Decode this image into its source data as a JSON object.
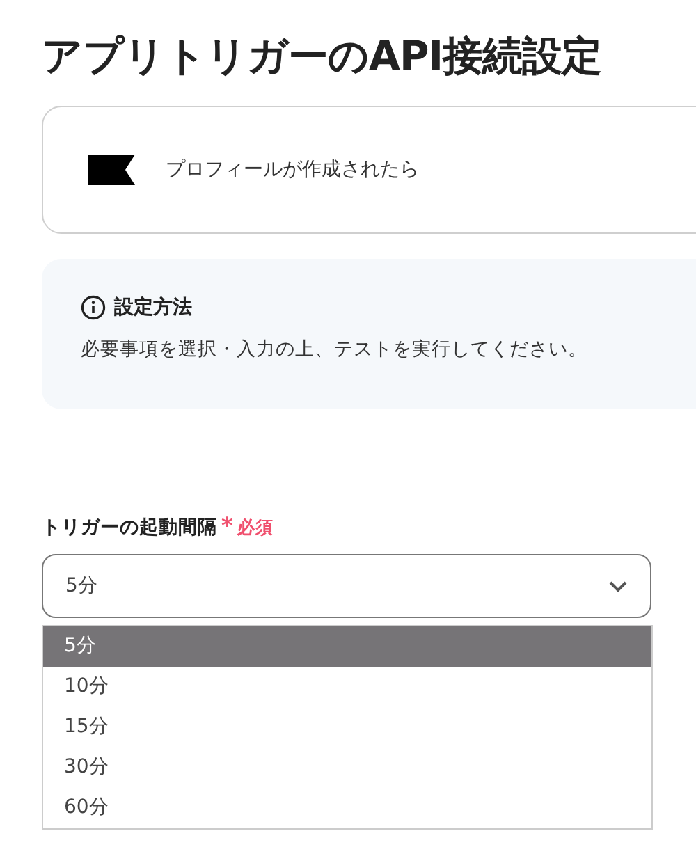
{
  "title": "アプリトリガーのAPI接続設定",
  "trigger_card": {
    "label": "プロフィールが作成されたら"
  },
  "info": {
    "heading": "設定方法",
    "text": "必要事項を選択・入力の上、テストを実行してください。"
  },
  "field": {
    "label": "トリガーの起動間隔",
    "required_mark": "*",
    "required_label": "必須",
    "value": "5分",
    "expanded": true,
    "options": [
      {
        "label": "5分",
        "selected": true
      },
      {
        "label": "10分",
        "selected": false
      },
      {
        "label": "15分",
        "selected": false
      },
      {
        "label": "30分",
        "selected": false
      },
      {
        "label": "60分",
        "selected": false
      }
    ]
  }
}
